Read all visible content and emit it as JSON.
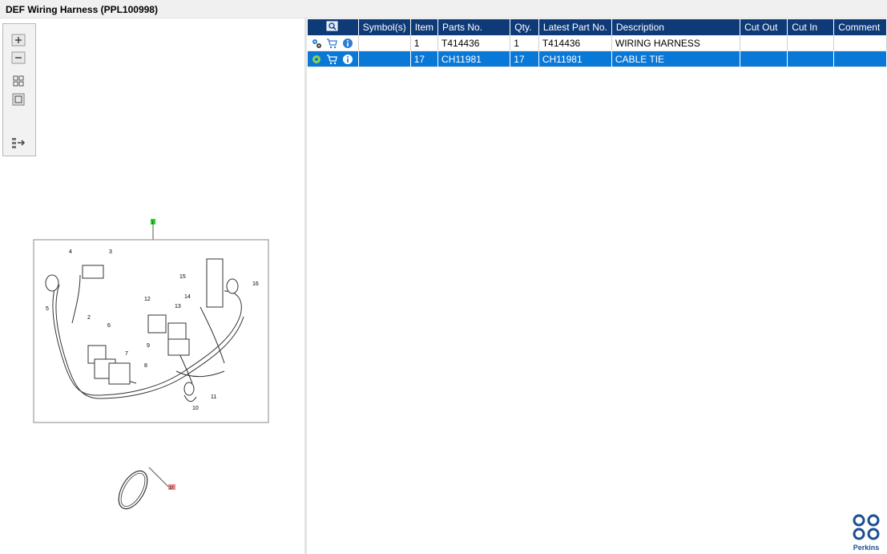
{
  "window": {
    "title": "DEF Wiring Harness (PPL100998)"
  },
  "toolbar": {
    "buttons": [
      {
        "name": "zoom-in",
        "icon": "plus-icon"
      },
      {
        "name": "zoom-out",
        "icon": "minus-icon"
      },
      {
        "name": "fit-all",
        "icon": "fit-icon"
      },
      {
        "name": "actual-size",
        "icon": "square-icon"
      },
      {
        "name": "export",
        "icon": "export-icon"
      }
    ]
  },
  "diagram": {
    "callouts": [
      "1",
      "2",
      "3",
      "4",
      "5",
      "6",
      "7",
      "8",
      "9",
      "10",
      "11",
      "12",
      "13",
      "14",
      "15",
      "16",
      "17"
    ],
    "highlight_colors": {
      "item1": "#2ad52a",
      "item17": "#f28b8b"
    }
  },
  "table": {
    "columns": [
      "",
      "Symbol(s)",
      "Item",
      "Parts No.",
      "Qty.",
      "Latest Part No.",
      "Description",
      "Cut Out",
      "Cut In",
      "Comment"
    ],
    "rows": [
      {
        "icons": [
          "gears-icon",
          "cart-icon",
          "info-icon"
        ],
        "symbols": "",
        "item": "1",
        "part_no": "T414436",
        "qty": "1",
        "latest_part_no": "T414436",
        "description": "WIRING HARNESS",
        "cut_out": "",
        "cut_in": "",
        "comment": "",
        "selected": false
      },
      {
        "icons": [
          "gear-icon",
          "cart-icon",
          "info-icon"
        ],
        "symbols": "",
        "item": "17",
        "part_no": "CH11981",
        "qty": "17",
        "latest_part_no": "CH11981",
        "description": "CABLE TIE",
        "cut_out": "",
        "cut_in": "",
        "comment": "",
        "selected": true
      }
    ]
  },
  "brand": {
    "name": "Perkins",
    "color": "#1d4f91"
  },
  "colors": {
    "header_bg": "#0f3a78",
    "selected_row": "#0a78d7"
  }
}
